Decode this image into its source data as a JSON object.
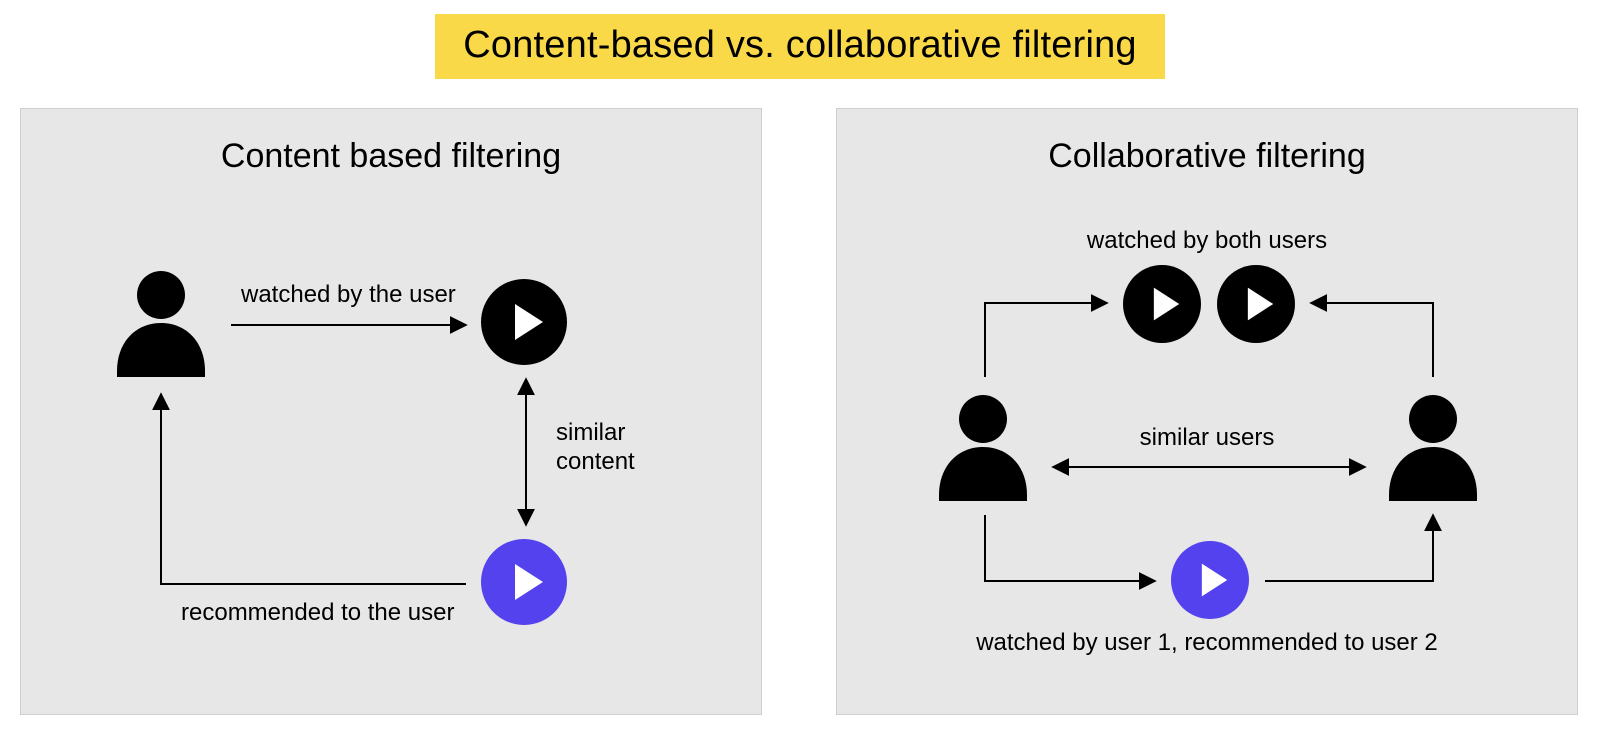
{
  "title": "Content-based vs. collaborative filtering",
  "colors": {
    "title_bg": "#fad949",
    "panel_bg": "#e7e7e7",
    "accent_play": "#5342ed",
    "fg": "#000000",
    "play_triangle": "#ffffff"
  },
  "panels": {
    "content_based": {
      "title": "Content based filtering",
      "labels": {
        "watched": "watched by the user",
        "similar": "similar\ncontent",
        "recommended": "recommended to the user"
      },
      "icons": [
        "user-icon",
        "play-icon-black",
        "play-icon-accent"
      ]
    },
    "collaborative": {
      "title": "Collaborative filtering",
      "labels": {
        "watched_both": "watched by both users",
        "similar_users": "similar users",
        "user1_reco_user2": "watched by user 1, recommended to user 2"
      },
      "icons": [
        "user-icon",
        "user-icon",
        "play-icon-black",
        "play-icon-black",
        "play-icon-accent"
      ]
    }
  }
}
